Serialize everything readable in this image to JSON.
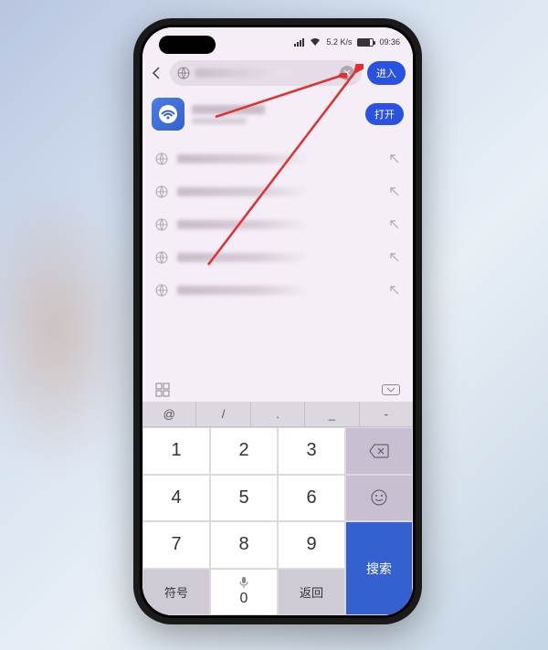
{
  "status": {
    "network_speed": "5.2 K/s",
    "time": "09:36"
  },
  "address_bar": {
    "input_value": "1",
    "placeholder": "",
    "enter_label": "进入"
  },
  "suggestion_card": {
    "open_label": "打开"
  },
  "history_items": [
    "",
    "",
    "",
    "",
    ""
  ],
  "keyboard": {
    "symbols": [
      "@",
      "/",
      ".",
      "_",
      "-"
    ],
    "numbers": [
      [
        "1",
        "2",
        "3"
      ],
      [
        "4",
        "5",
        "6"
      ],
      [
        "7",
        "8",
        "9"
      ]
    ],
    "bottom_row": {
      "mode": "符号",
      "zero": "0",
      "return": "返回"
    },
    "side": {
      "search": "搜索"
    }
  }
}
